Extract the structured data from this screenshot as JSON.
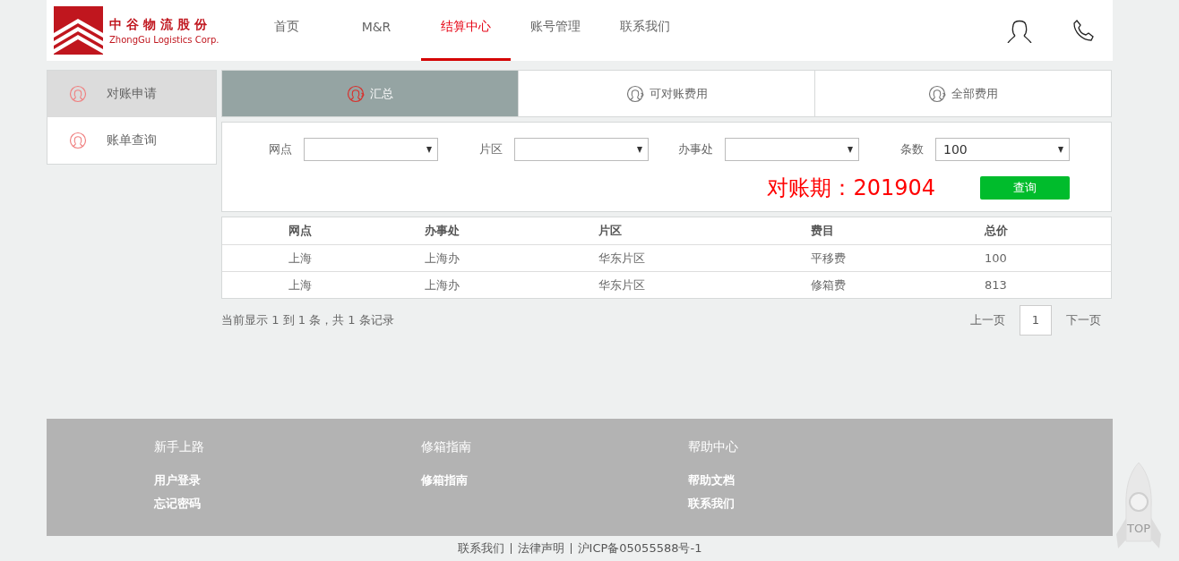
{
  "logo": {
    "name": "中谷物流股份",
    "subtitle": "ZhongGu Logistics Corp."
  },
  "nav": [
    {
      "label": "首页",
      "selected": false
    },
    {
      "label": "M&R",
      "selected": false
    },
    {
      "label": "结算中心",
      "selected": true
    },
    {
      "label": "账号管理",
      "selected": false
    },
    {
      "label": "联系我们",
      "selected": false
    }
  ],
  "sidebar": {
    "items": [
      {
        "label": "对账申请",
        "selected": true
      },
      {
        "label": "账单查询",
        "selected": false
      }
    ]
  },
  "tabs": [
    {
      "label": "汇总",
      "selected": true
    },
    {
      "label": "可对账费用",
      "selected": false
    },
    {
      "label": "全部费用",
      "selected": false
    }
  ],
  "filters": [
    {
      "label": "网点"
    },
    {
      "label": "片区"
    },
    {
      "label": "办事处"
    },
    {
      "label": "条数",
      "value": "100"
    }
  ],
  "period": "对账期：201904",
  "query_button": "查询",
  "table": {
    "columns": [
      "网点",
      "办事处",
      "片区",
      "费目",
      "总价"
    ],
    "rows": [
      [
        "上海",
        "上海办",
        "华东片区",
        "平移费",
        "100"
      ],
      [
        "上海",
        "上海办",
        "华东片区",
        "修箱费",
        "813"
      ]
    ]
  },
  "pagination": {
    "summary": "当前显示 1 到 1 条，共 1 条记录",
    "prev": "上一页",
    "pages": [
      {
        "label": "1",
        "selected": true
      }
    ],
    "next": "下一页"
  },
  "footer": {
    "columns": [
      {
        "heading": "新手上路",
        "links": [
          "用户登录",
          "忘记密码"
        ]
      },
      {
        "heading": "修箱指南",
        "links": [
          "修箱指南"
        ]
      },
      {
        "heading": "帮助中心",
        "links": [
          "帮助文档",
          "联系我们"
        ]
      }
    ],
    "bottom_links": [
      "联系我们",
      "法律声明",
      "沪ICP备05055588号-1"
    ]
  },
  "back_to_top": "TOP"
}
